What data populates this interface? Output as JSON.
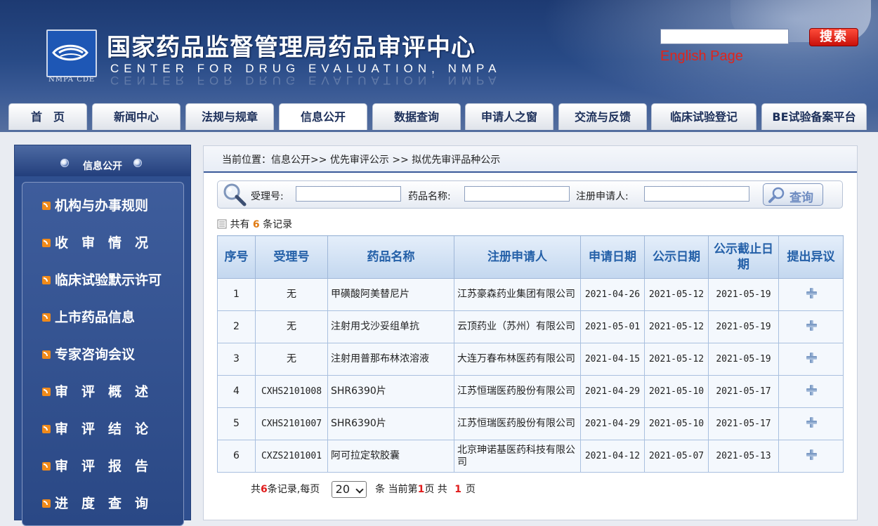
{
  "header": {
    "title_cn": "国家药品监督管理局药品审评中心",
    "title_en": "CENTER FOR DRUG EVALUATION, NMPA",
    "logo_caption": "NMPA CDE",
    "search_value": "",
    "search_button": "搜索",
    "english_link": "English Page"
  },
  "nav": {
    "tabs": [
      {
        "label": "首　页"
      },
      {
        "label": "新闻中心"
      },
      {
        "label": "法规与规章"
      },
      {
        "label": "信息公开"
      },
      {
        "label": "数据查询"
      },
      {
        "label": "申请人之窗"
      },
      {
        "label": "交流与反馈"
      },
      {
        "label": "临床试验登记"
      },
      {
        "label": "BE试验备案平台"
      }
    ],
    "active": "信息公开"
  },
  "sidebar": {
    "title": "信息公开",
    "items": [
      {
        "label": "机构与办事规则"
      },
      {
        "label": "收　审　情　况"
      },
      {
        "label": "临床试验默示许可"
      },
      {
        "label": "上市药品信息"
      },
      {
        "label": "专家咨询会议"
      },
      {
        "label": "审　评　概　述"
      },
      {
        "label": "审　评　结　论"
      },
      {
        "label": "审　评　报　告"
      },
      {
        "label": "进　度　查　询"
      }
    ]
  },
  "breadcrumb": "当前位置：信息公开>> 优先审评公示 >> 拟优先审评品种公示",
  "filter": {
    "acceptance_label": "受理号:",
    "acceptance_value": "",
    "drug_name_label": "药品名称:",
    "drug_name_value": "",
    "applicant_label": "注册申请人:",
    "applicant_value": "",
    "query_button": "查询"
  },
  "records": {
    "prefix": "共有",
    "count": "6",
    "suffix": "条记录"
  },
  "table": {
    "headers": [
      "序号",
      "受理号",
      "药品名称",
      "注册申请人",
      "申请日期",
      "公示日期",
      "公示截止日期",
      "提出异议"
    ],
    "rows": [
      {
        "no": "1",
        "acceptance": "无",
        "drug": "甲磺酸阿美替尼片",
        "applicant": "江苏豪森药业集团有限公司",
        "apply_date": "2021-04-26",
        "publish_date": "2021-05-12",
        "deadline": "2021-05-19"
      },
      {
        "no": "2",
        "acceptance": "无",
        "drug": "注射用戈沙妥组单抗",
        "applicant": "云顶药业（苏州）有限公司",
        "apply_date": "2021-05-01",
        "publish_date": "2021-05-12",
        "deadline": "2021-05-19"
      },
      {
        "no": "3",
        "acceptance": "无",
        "drug": "注射用普那布林浓溶液",
        "applicant": "大连万春布林医药有限公司",
        "apply_date": "2021-04-15",
        "publish_date": "2021-05-12",
        "deadline": "2021-05-19"
      },
      {
        "no": "4",
        "acceptance": "CXHS2101008",
        "drug": "SHR6390片",
        "applicant": "江苏恒瑞医药股份有限公司",
        "apply_date": "2021-04-29",
        "publish_date": "2021-05-10",
        "deadline": "2021-05-17"
      },
      {
        "no": "5",
        "acceptance": "CXHS2101007",
        "drug": "SHR6390片",
        "applicant": "江苏恒瑞医药股份有限公司",
        "apply_date": "2021-04-29",
        "publish_date": "2021-05-10",
        "deadline": "2021-05-17"
      },
      {
        "no": "6",
        "acceptance": "CXZS2101001",
        "drug": "阿可拉定软胶囊",
        "applicant": "北京珅诺基医药科技有限公司",
        "apply_date": "2021-04-12",
        "publish_date": "2021-05-07",
        "deadline": "2021-05-13"
      }
    ],
    "objection_icon": "plus-icon"
  },
  "pager": {
    "total_prefix": "共",
    "total": "6",
    "total_suffix": "条记录,每页",
    "page_size": "20",
    "unit": "条",
    "current_prefix": "当前第",
    "current": "1",
    "current_suffix": "页 共",
    "pages": "1",
    "pages_suffix": "页"
  },
  "colors": {
    "header_blue": "#284a86",
    "accent_red": "#e0241b",
    "count_orange": "#e07b14",
    "table_header_text": "#2460a8"
  }
}
